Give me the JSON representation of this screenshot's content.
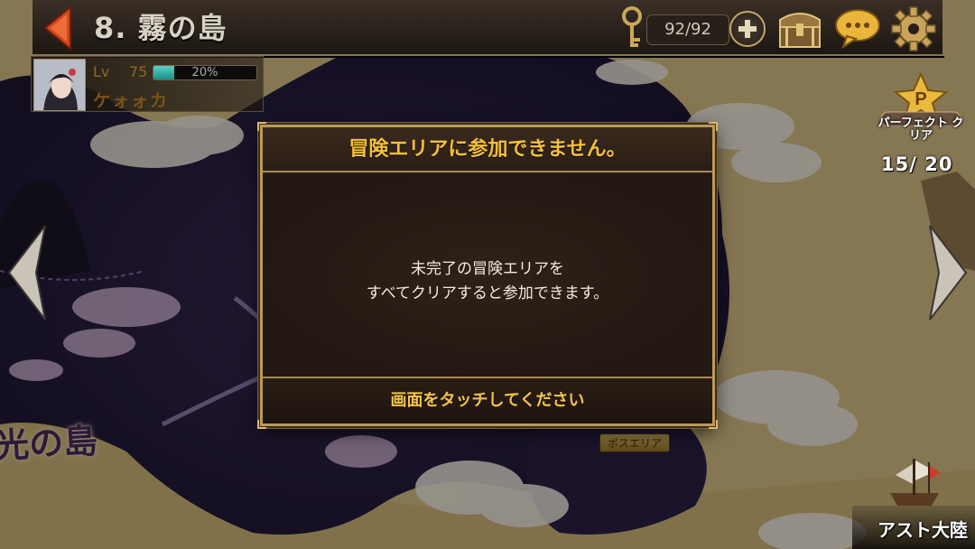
{
  "header": {
    "stage_title": "8. 霧の島",
    "stamina": "92/92"
  },
  "icons": {
    "back": "back-arrow-icon",
    "key": "key-icon",
    "add": "plus-icon",
    "chest": "treasure-chest-icon",
    "chat": "chat-bubble-icon",
    "settings": "gear-icon"
  },
  "player": {
    "level_label": "Lv",
    "level": "75",
    "exp_percent": "20%",
    "exp_fraction": 0.2,
    "name": "ケォォカ"
  },
  "perfect_clear": {
    "badge_letter": "P",
    "label": "パーフェクト クリア",
    "count": "15/ 20"
  },
  "map": {
    "island_label": "光の島",
    "boss_area_label": "ボスエリア",
    "continent_label": "アスト大陸"
  },
  "dialog": {
    "title": "冒険エリアに参加できません。",
    "message_line1": "未完了の冒険エリアを",
    "message_line2": "すべてクリアすると参加できます。",
    "footer": "画面をタッチしてください"
  },
  "colors": {
    "dialog_title": "#f4c03a",
    "dialog_border": "#b99a5a",
    "exp_fill": "#3fbdb1"
  }
}
